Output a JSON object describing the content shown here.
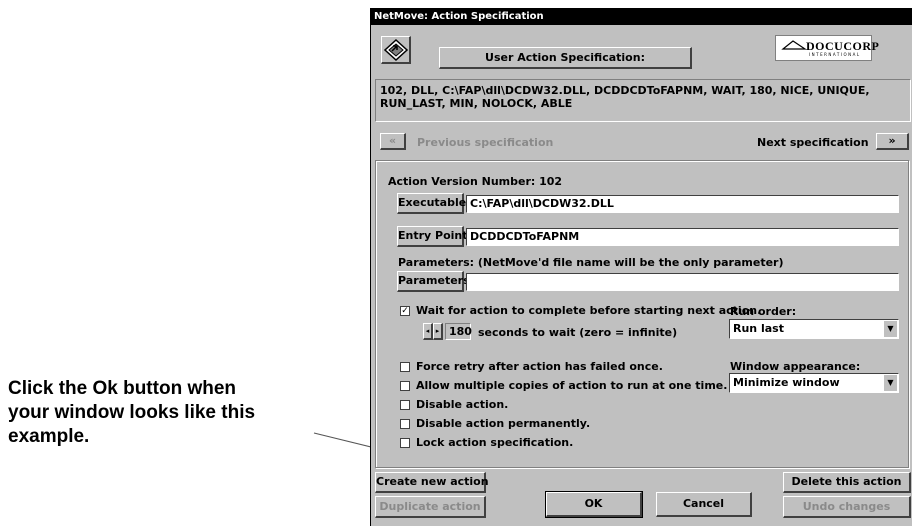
{
  "callout": {
    "lines": [
      "Click the Ok button when",
      "your window looks like this",
      "example."
    ]
  },
  "window": {
    "title": "NetMove: Action Specification",
    "header_label": "User Action Specification:",
    "logo_text": "DOCUCORP",
    "logo_subtext": "INTERNATIONAL",
    "spec_line1": "102, DLL, C:\\FAP\\dll\\DCDW32.DLL, DCDDCDToFAPNM, WAIT, 180, NICE, UNIQUE,",
    "spec_line2": "RUN_LAST, MIN, NOLOCK, ABLE"
  },
  "nav": {
    "prev_symbol": "«",
    "prev_label": "Previous specification",
    "next_label": "Next specification",
    "next_symbol": "»"
  },
  "form": {
    "version_label": "Action Version Number: 102",
    "executable_button": "Executable",
    "executable_value": "C:\\FAP\\dll\\DCDW32.DLL",
    "entry_point_button": "Entry Point",
    "entry_point_value": "DCDDCDToFAPNM",
    "parameters_note": "Parameters: (NetMove'd file name will be the only parameter)",
    "parameters_button": "Parameters",
    "parameters_value": "",
    "wait_label": "Wait for action to complete before starting next action.",
    "wait_checked": "✓",
    "seconds_value": "180",
    "seconds_label": "seconds to wait (zero = infinite)",
    "run_order_label": "Run order:",
    "run_order_value": "Run last",
    "window_appearance_label": "Window appearance:",
    "window_appearance_value": "Minimize window",
    "options": [
      "Force retry after action has failed once.",
      "Allow multiple copies of action to run at one time.",
      "Disable action.",
      "Disable action permanently.",
      "Lock action specification."
    ]
  },
  "footer": {
    "create": "Create new action",
    "delete": "Delete this action",
    "duplicate": "Duplicate action",
    "ok": "OK",
    "cancel": "Cancel",
    "undo": "Undo changes"
  },
  "icons": {
    "app_icon": "diamond-arrow-icon",
    "dropdown": "chevron-down-icon",
    "spinner_left": "triangle-left-icon",
    "spinner_right": "triangle-right-icon"
  }
}
